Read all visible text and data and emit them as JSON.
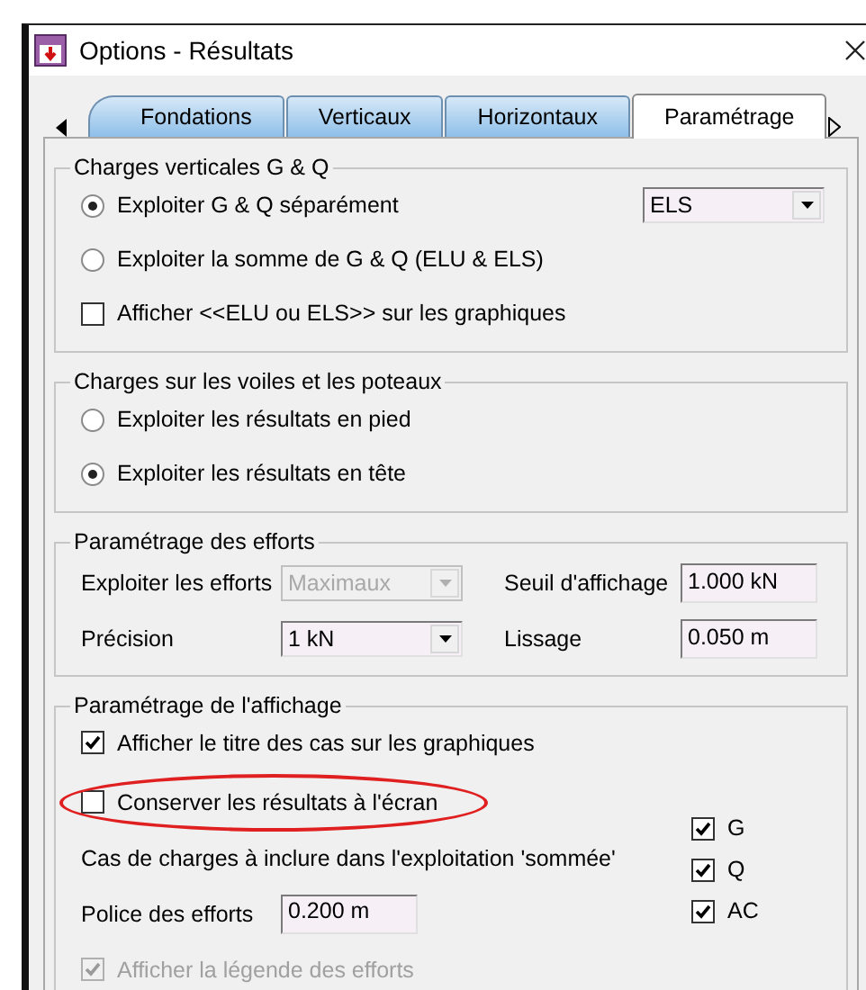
{
  "window": {
    "title": "Options - Résultats"
  },
  "tabs": [
    {
      "label": "Fondations",
      "selected": false
    },
    {
      "label": "Verticaux",
      "selected": false
    },
    {
      "label": "Horizontaux",
      "selected": false
    },
    {
      "label": "Paramétrage",
      "selected": true
    }
  ],
  "groups": [
    {
      "title": "Charges verticales G & Q",
      "kind": "options",
      "items": [
        {
          "kind": "radio",
          "label": "Exploiter G & Q séparément",
          "selected": true,
          "combo": {
            "value": "ELS"
          }
        },
        {
          "kind": "radio",
          "label": "Exploiter la somme de G & Q (ELU & ELS)",
          "selected": false
        },
        {
          "kind": "checkbox",
          "label": "Afficher <<ELU ou ELS>> sur les graphiques",
          "checked": false
        }
      ]
    },
    {
      "title": "Charges sur les voiles et les poteaux",
      "kind": "options",
      "items": [
        {
          "kind": "radio",
          "label": "Exploiter les résultats en pied",
          "selected": false
        },
        {
          "kind": "radio",
          "label": "Exploiter les résultats en tête",
          "selected": true
        }
      ]
    },
    {
      "title": "Paramétrage des efforts",
      "kind": "grid",
      "items": [
        {
          "kind": "combo",
          "label": "Exploiter les efforts",
          "value": "Maximaux",
          "disabled": true
        },
        {
          "kind": "field",
          "label": "Seuil d'affichage",
          "value": "1.000 kN"
        },
        {
          "kind": "combo",
          "label": "Précision",
          "value": "1 kN",
          "disabled": false
        },
        {
          "kind": "field",
          "label": "Lissage",
          "value": "0.050 m"
        }
      ]
    },
    {
      "title": "Paramétrage de l'affichage",
      "kind": "display",
      "items": [
        {
          "kind": "checkbox",
          "label": "Afficher le titre des cas sur les graphiques",
          "checked": true,
          "disabled": false,
          "highlighted": false
        },
        {
          "kind": "checkbox",
          "label": "Conserver les résultats à l'écran",
          "checked": false,
          "disabled": false,
          "highlighted": true
        },
        {
          "kind": "text",
          "label": "Cas de charges à inclure dans l'exploitation 'sommée'"
        },
        {
          "kind": "field",
          "label": "Police des efforts",
          "value": "0.200 m"
        },
        {
          "kind": "checkbox",
          "label": "Afficher la légende des efforts",
          "checked": true,
          "disabled": true,
          "highlighted": false
        }
      ],
      "side_items": [
        {
          "kind": "checkbox",
          "label": "G",
          "checked": true
        },
        {
          "kind": "checkbox",
          "label": "Q",
          "checked": true
        },
        {
          "kind": "checkbox",
          "label": "AC",
          "checked": true
        }
      ]
    }
  ]
}
